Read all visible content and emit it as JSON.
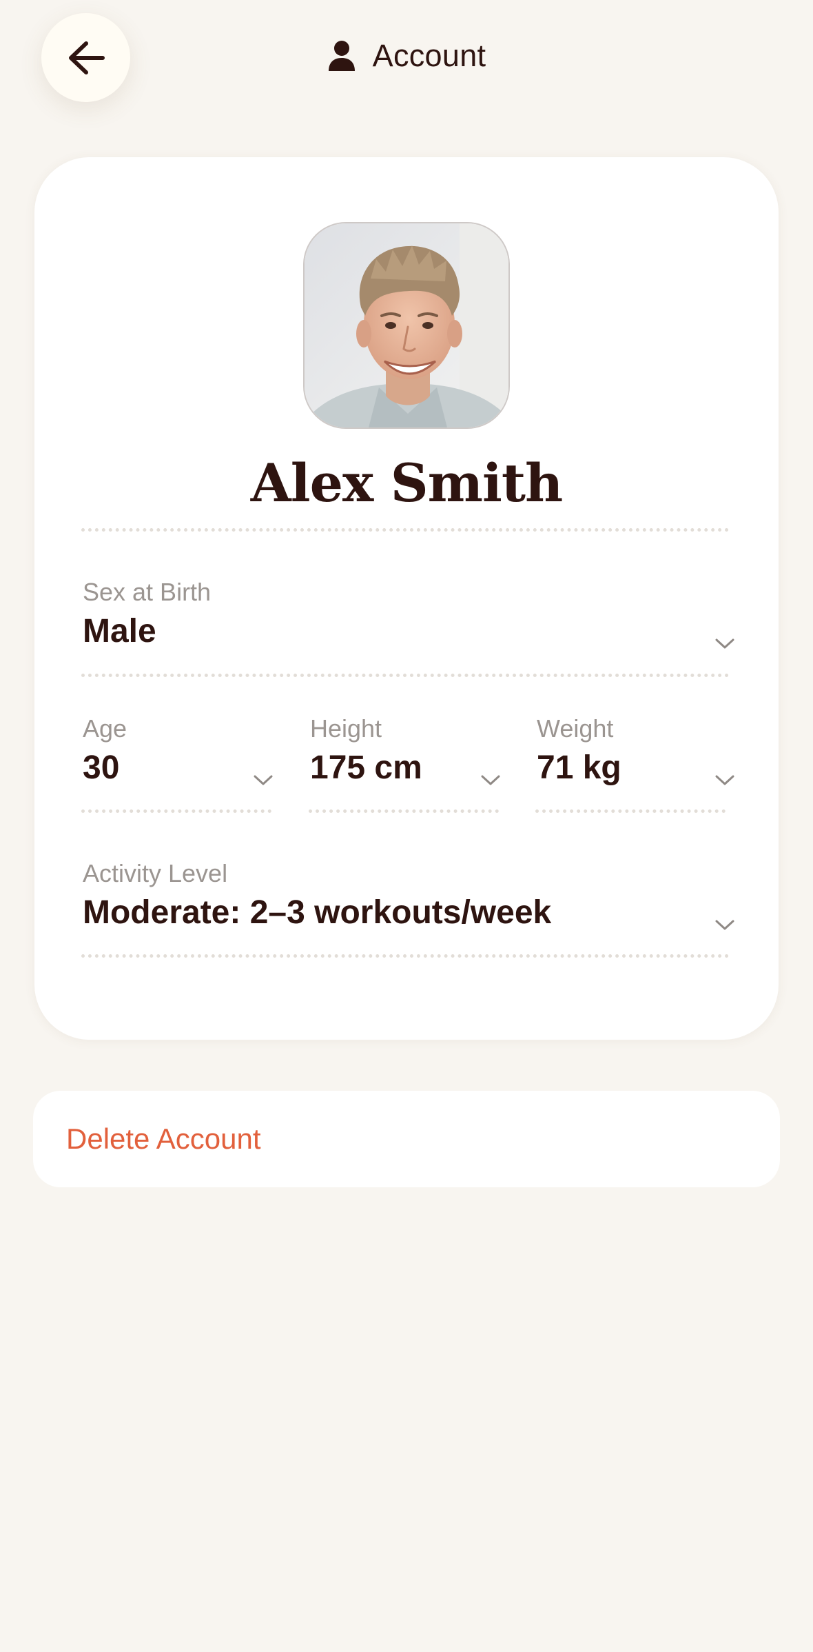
{
  "header": {
    "title": "Account",
    "back_icon": "arrow-left-icon",
    "title_icon": "person-icon"
  },
  "profile": {
    "name": "Alex Smith",
    "avatar": "profile-photo"
  },
  "fields": {
    "sex": {
      "label": "Sex at Birth",
      "value": "Male"
    },
    "age": {
      "label": "Age",
      "value": "30"
    },
    "height": {
      "label": "Height",
      "value": "175 cm"
    },
    "weight": {
      "label": "Weight",
      "value": "71 kg"
    },
    "activity": {
      "label": "Activity Level",
      "value": "Moderate: 2–3 workouts/week"
    }
  },
  "actions": {
    "delete_label": "Delete Account"
  },
  "colors": {
    "background": "#f8f5f0",
    "card": "#ffffff",
    "text_primary": "#2e1410",
    "text_muted": "#9b9591",
    "danger": "#e2603c"
  }
}
